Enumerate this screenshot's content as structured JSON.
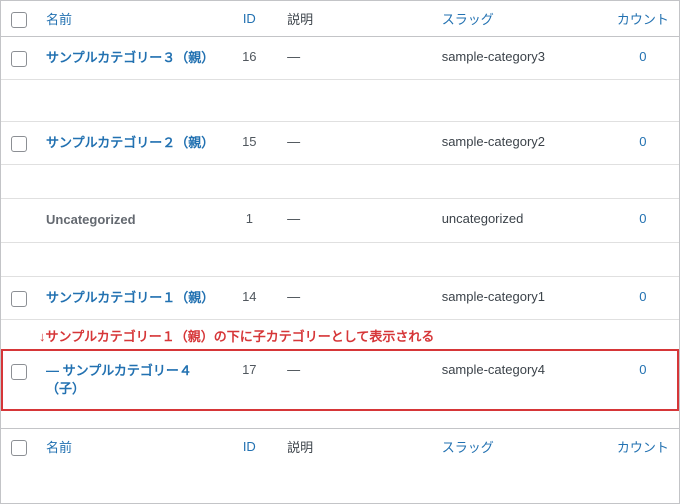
{
  "headers": {
    "name": "名前",
    "id": "ID",
    "description": "説明",
    "slug": "スラッグ",
    "count": "カウント"
  },
  "rows": [
    {
      "name": "サンプルカテゴリー３（親）",
      "id": "16",
      "description": "—",
      "slug": "sample-category3",
      "count": "0",
      "linkStyle": "normal",
      "checkbox": true
    },
    {
      "name": "サンプルカテゴリー２（親）",
      "id": "15",
      "description": "—",
      "slug": "sample-category2",
      "count": "0",
      "linkStyle": "normal",
      "checkbox": true
    },
    {
      "name": "Uncategorized",
      "id": "1",
      "description": "—",
      "slug": "uncategorized",
      "count": "0",
      "linkStyle": "uncat",
      "checkbox": false
    },
    {
      "name": "サンプルカテゴリー１（親）",
      "id": "14",
      "description": "—",
      "slug": "sample-category1",
      "count": "0",
      "linkStyle": "normal",
      "checkbox": true
    },
    {
      "name": "— サンプルカテゴリー４（子）",
      "id": "17",
      "description": "—",
      "slug": "sample-category4",
      "count": "0",
      "linkStyle": "normal",
      "checkbox": true,
      "highlight": true
    }
  ],
  "annotation": "↓サンプルカテゴリー１（親）の下に子カテゴリーとして表示される"
}
